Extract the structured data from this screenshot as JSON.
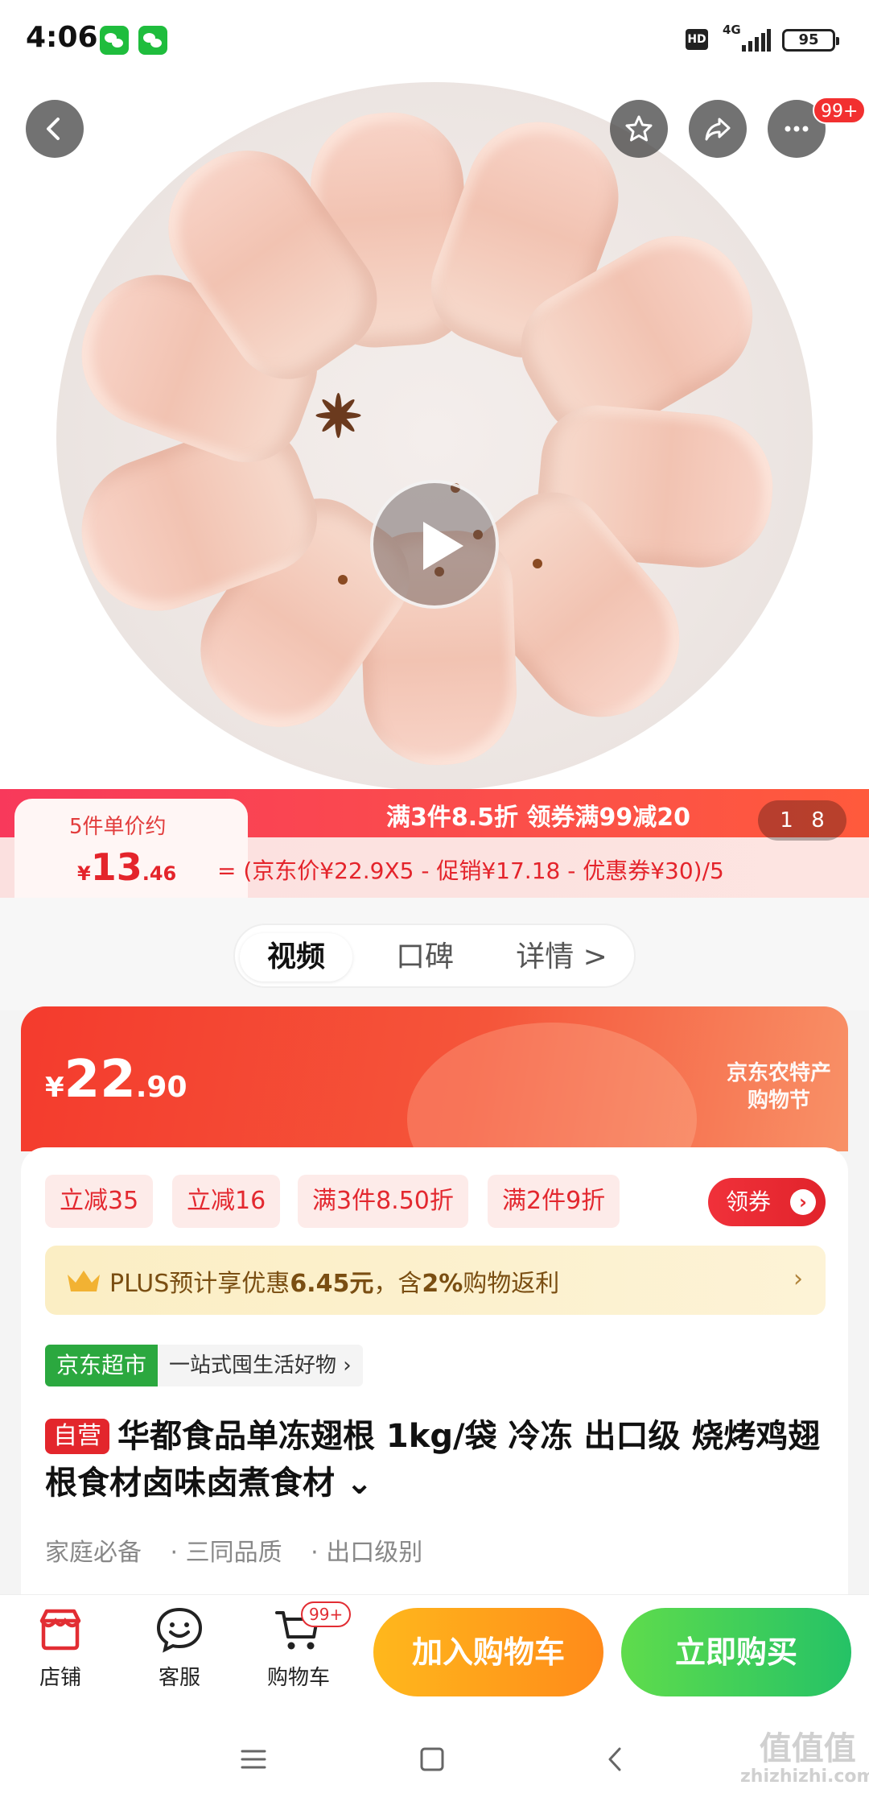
{
  "status_bar": {
    "time": "4:06",
    "hd": "HD",
    "network": "4G",
    "battery": "95"
  },
  "top_actions": {
    "more_badge": "99+"
  },
  "promo": {
    "title": "满3件8.5折 领券满99减20",
    "unit_label": "5件单价约",
    "unit_currency": "¥",
    "unit_price_int": "13",
    "unit_price_dec": ".46",
    "formula": "= (京东价¥22.9X5 - 促销¥17.18 - 优惠券¥30)/5",
    "pager_current": "1",
    "pager_total": "8"
  },
  "tabs": [
    {
      "label": "视频"
    },
    {
      "label": "口碑"
    },
    {
      "label": "详情 >"
    }
  ],
  "price": {
    "currency": "¥",
    "int": "22",
    "dec": ".90",
    "festival_line1": "京东农特产",
    "festival_line2": "购物节"
  },
  "chips": [
    {
      "label": "立减35"
    },
    {
      "label": "立减16"
    },
    {
      "label": "满3件8.50折"
    },
    {
      "label": "满2件9折"
    }
  ],
  "coupon": {
    "label": "领券",
    "arrow": "›"
  },
  "plus": {
    "text_prefix": "PLUS预计享优惠",
    "amount": "6.45元",
    "text_mid": "，含",
    "rate": "2%",
    "text_suffix": "购物返利",
    "chevron": "›"
  },
  "market": {
    "tag": "京东超市",
    "slogan": "一站式囤生活好物 ›"
  },
  "product": {
    "self_tag": "自营",
    "title": "华都食品单冻翅根 1kg/袋 冷冻 出口级 烧烤鸡翅根食材卤味卤煮食材 ⌄"
  },
  "features": [
    "家庭必备",
    "· 三同品质",
    "· 出口级别"
  ],
  "action_bar": {
    "store": "店铺",
    "service": "客服",
    "cart": "购物车",
    "cart_badge": "99+",
    "add_to_cart": "加入购物车",
    "buy_now": "立即购买"
  },
  "watermark": {
    "line1": "值值值",
    "line2": "zhizhizhi.com"
  }
}
